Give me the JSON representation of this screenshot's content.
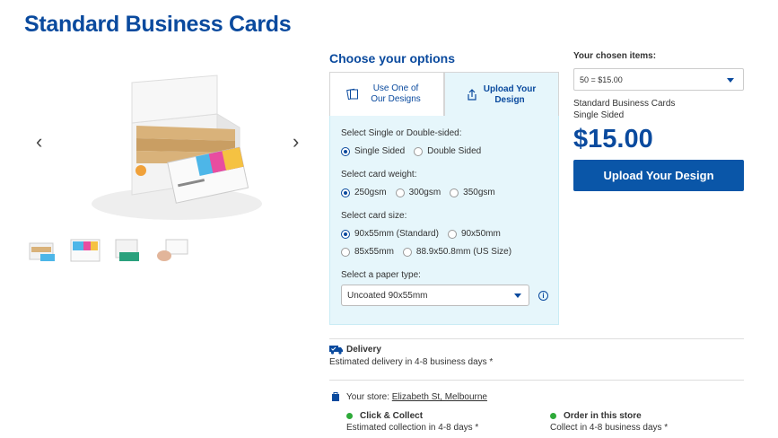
{
  "page": {
    "title": "Standard Business Cards"
  },
  "gallery": {
    "prev_arrow": "‹",
    "next_arrow": "›",
    "thumbnail_count": 4
  },
  "options": {
    "heading": "Choose your options",
    "tabs": [
      {
        "label": "Use One of Our Designs",
        "active": false,
        "icon": "pages-icon"
      },
      {
        "label": "Upload Your Design",
        "active": true,
        "icon": "upload-icon"
      }
    ],
    "sides": {
      "label": "Select Single or Double-sided:",
      "options": [
        "Single Sided",
        "Double Sided"
      ],
      "selected": "Single Sided"
    },
    "weight": {
      "label": "Select card weight:",
      "options": [
        "250gsm",
        "300gsm",
        "350gsm"
      ],
      "selected": "250gsm"
    },
    "size": {
      "label": "Select card size:",
      "options": [
        "90x55mm (Standard)",
        "90x50mm",
        "85x55mm",
        "88.9x50.8mm (US Size)"
      ],
      "selected": "90x55mm (Standard)"
    },
    "paper": {
      "label": "Select a paper type:",
      "value": "Uncoated 90x55mm",
      "info_symbol": "i"
    }
  },
  "summary": {
    "chosen_label": "Your chosen items:",
    "quantity_value": "50 = $15.00",
    "product_name": "Standard Business Cards",
    "product_variant": "Single Sided",
    "price": "$15.00",
    "upload_button": "Upload Your Design"
  },
  "delivery": {
    "title": "Delivery",
    "estimate": "Estimated delivery in 4-8 business days *",
    "store_label": "Your store:",
    "store_name": "Elizabeth St, Melbourne",
    "click_collect_title": "Click & Collect",
    "click_collect_text": "Estimated collection in 4-8 days *",
    "order_store_title": "Order in this store",
    "order_store_text": "Collect in 4-8 business days *",
    "status_color": "#2eaa3a"
  },
  "colors": {
    "brand": "#0a4a9e",
    "button": "#0a56a8",
    "panel": "#e6f6fb"
  }
}
